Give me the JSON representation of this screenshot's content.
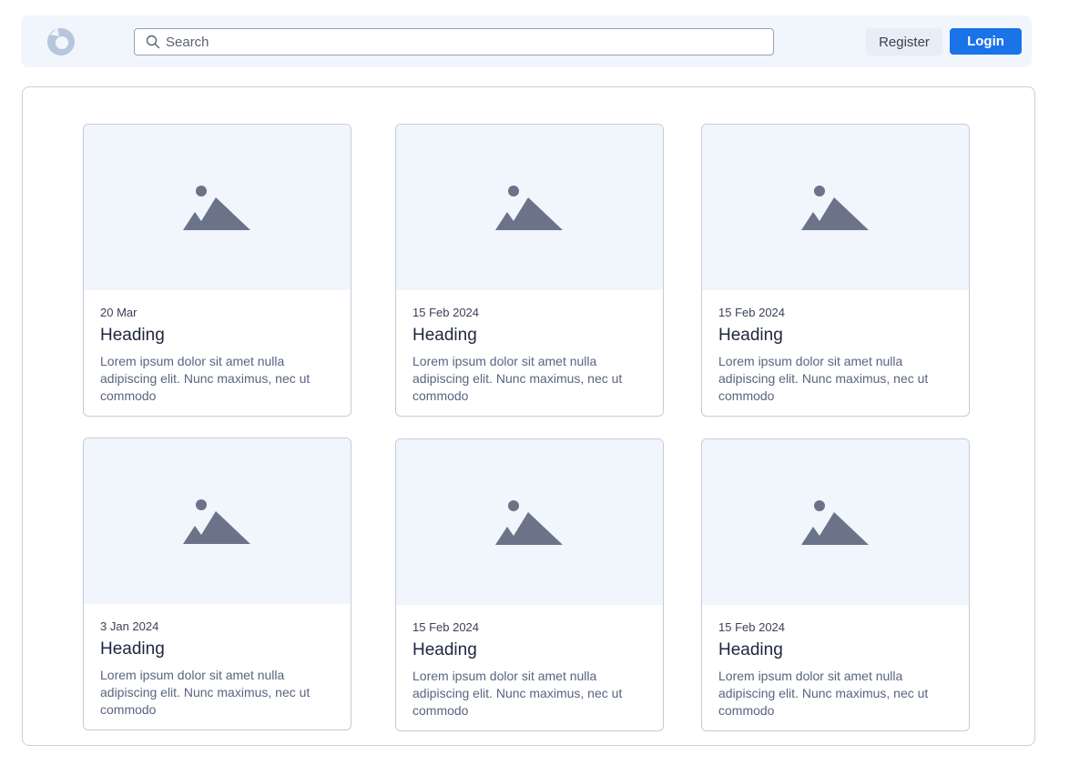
{
  "header": {
    "logo_icon": "logo-icon",
    "search": {
      "placeholder": "Search",
      "value": ""
    },
    "register_label": "Register",
    "login_label": "Login"
  },
  "colors": {
    "header_bg": "#f1f5fc",
    "accent": "#1a73e8",
    "image_placeholder": "#6b7389"
  },
  "cards": [
    {
      "date": "20 Mar",
      "heading": "Heading",
      "text": "Lorem ipsum dolor sit amet nulla adipiscing elit. Nunc maximus, nec ut commodo",
      "icon": "image-placeholder-icon"
    },
    {
      "date": "15 Feb 2024",
      "heading": "Heading",
      "text": "Lorem ipsum dolor sit amet nulla adipiscing elit. Nunc maximus, nec ut commodo",
      "icon": "image-placeholder-icon"
    },
    {
      "date": "15 Feb 2024",
      "heading": "Heading",
      "text": "Lorem ipsum dolor sit amet nulla adipiscing elit. Nunc maximus, nec ut commodo",
      "icon": "image-placeholder-icon"
    },
    {
      "date": "3 Jan 2024",
      "heading": "Heading",
      "text": "Lorem ipsum dolor sit amet nulla adipiscing elit. Nunc maximus, nec ut commodo",
      "icon": "image-placeholder-icon"
    },
    {
      "date": "15 Feb 2024",
      "heading": "Heading",
      "text": "Lorem ipsum dolor sit amet nulla adipiscing elit. Nunc maximus, nec ut commodo",
      "icon": "image-placeholder-icon"
    },
    {
      "date": "15 Feb 2024",
      "heading": "Heading",
      "text": "Lorem ipsum dolor sit amet nulla adipiscing elit. Nunc maximus, nec ut commodo",
      "icon": "image-placeholder-icon"
    }
  ]
}
